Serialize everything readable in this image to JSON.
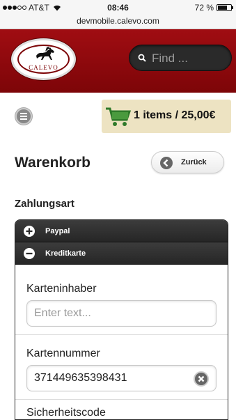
{
  "status_bar": {
    "carrier": "AT&T",
    "time": "08:46",
    "battery": "72 %",
    "battery_level": 0.72,
    "url": "devmobile.calevo.com"
  },
  "header": {
    "logo_text": "CALEVO",
    "search_placeholder": "Find ..."
  },
  "cart": {
    "label": "1 items / 25,00€"
  },
  "page": {
    "title": "Warenkorb",
    "back_label": "Zurück"
  },
  "payment": {
    "section_title": "Zahlungsart",
    "options": [
      {
        "label": "Paypal",
        "icon": "plus-icon",
        "expanded": false
      },
      {
        "label": "Kreditkarte",
        "icon": "minus-icon",
        "expanded": true
      }
    ],
    "fields": [
      {
        "label": "Karteninhaber",
        "placeholder": "Enter text...",
        "value": ""
      },
      {
        "label": "Kartennummer",
        "placeholder": "",
        "value": "371449635398431"
      },
      {
        "label": "Sicherheitscode"
      }
    ]
  },
  "colors": {
    "header_red": "#9a0b10",
    "cart_bg": "#ede3c2",
    "accordion_dark": "#2e2e2e"
  }
}
